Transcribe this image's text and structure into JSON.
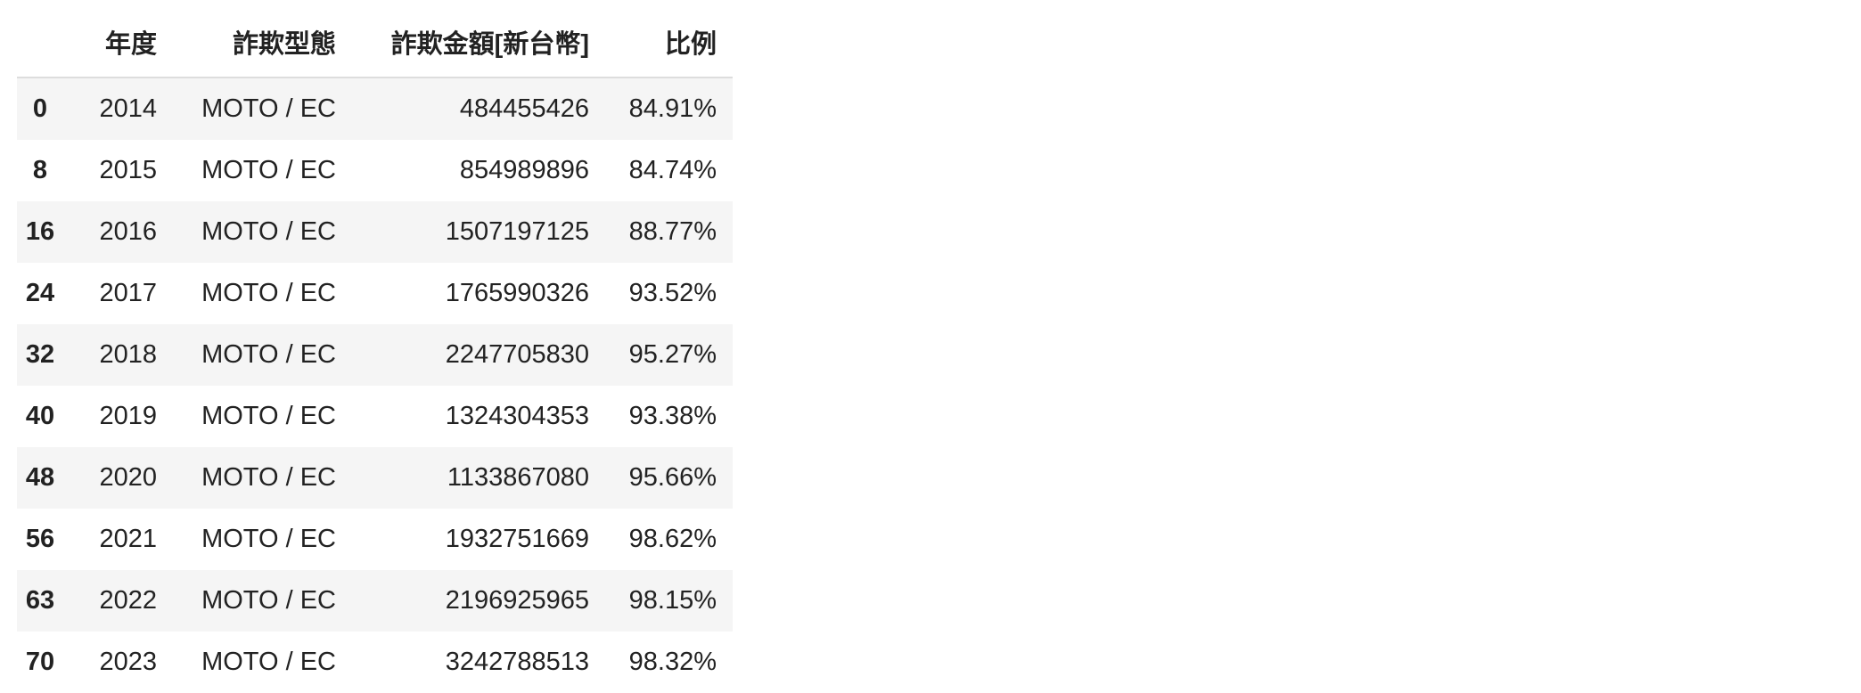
{
  "table": {
    "columns": [
      "",
      "年度",
      "詐欺型態",
      "詐欺金額[新台幣]",
      "比例"
    ],
    "rows": [
      {
        "index": "0",
        "year": "2014",
        "type": "MOTO / EC",
        "amount": "484455426",
        "ratio": "84.91%"
      },
      {
        "index": "8",
        "year": "2015",
        "type": "MOTO / EC",
        "amount": "854989896",
        "ratio": "84.74%"
      },
      {
        "index": "16",
        "year": "2016",
        "type": "MOTO / EC",
        "amount": "1507197125",
        "ratio": "88.77%"
      },
      {
        "index": "24",
        "year": "2017",
        "type": "MOTO / EC",
        "amount": "1765990326",
        "ratio": "93.52%"
      },
      {
        "index": "32",
        "year": "2018",
        "type": "MOTO / EC",
        "amount": "2247705830",
        "ratio": "95.27%"
      },
      {
        "index": "40",
        "year": "2019",
        "type": "MOTO / EC",
        "amount": "1324304353",
        "ratio": "93.38%"
      },
      {
        "index": "48",
        "year": "2020",
        "type": "MOTO / EC",
        "amount": "1133867080",
        "ratio": "95.66%"
      },
      {
        "index": "56",
        "year": "2021",
        "type": "MOTO / EC",
        "amount": "1932751669",
        "ratio": "98.62%"
      },
      {
        "index": "63",
        "year": "2022",
        "type": "MOTO / EC",
        "amount": "2196925965",
        "ratio": "98.15%"
      },
      {
        "index": "70",
        "year": "2023",
        "type": "MOTO / EC",
        "amount": "3242788513",
        "ratio": "98.32%"
      }
    ]
  }
}
